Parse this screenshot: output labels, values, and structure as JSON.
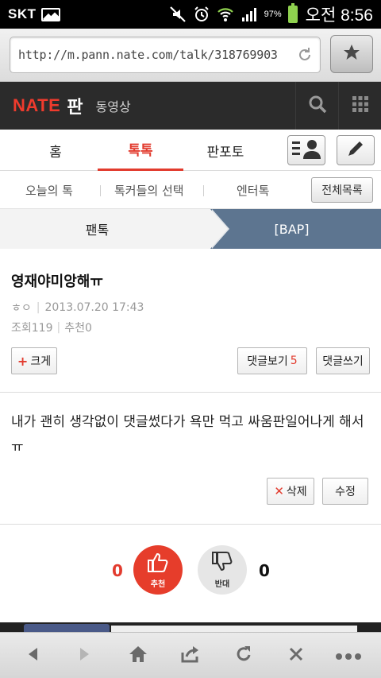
{
  "status_bar": {
    "carrier": "SKT",
    "battery_percent": "97%",
    "time": "오전 8:56"
  },
  "browser": {
    "url": "http://m.pann.nate.com/talk/318769903"
  },
  "header": {
    "logo": "NATE",
    "section": "판",
    "video_link": "동영상"
  },
  "main_tabs": [
    {
      "label": "홈",
      "active": false
    },
    {
      "label": "톡톡",
      "active": true
    },
    {
      "label": "판포토",
      "active": false
    }
  ],
  "sub_tabs": [
    {
      "label": "오늘의 톡"
    },
    {
      "label": "톡커들의 선택"
    },
    {
      "label": "엔터톡"
    }
  ],
  "all_list_button": "전체목록",
  "category": {
    "left": "팬톡",
    "right": "[BAP]"
  },
  "post": {
    "title": "영재야미앙해ㅠ",
    "author": "ㅎㅇ",
    "date": "2013.07.20 17:43",
    "views_label": "조회",
    "views": "119",
    "recommend_label": "추천",
    "recommend_count": "0",
    "enlarge_button": "크게",
    "view_comments_button": "댓글보기",
    "comment_count": "5",
    "write_comment_button": "댓글쓰기",
    "body": "내가 괜히 생각없이 댓글썼다가 욕만 먹고 싸움판일어나게 해서ㅠ",
    "delete_button": "삭제",
    "edit_button": "수정"
  },
  "vote": {
    "up_count": "0",
    "up_label": "추천",
    "down_label": "반대",
    "down_count": "0"
  },
  "colors": {
    "accent": "#e23b2e",
    "header_bg": "#2b2b2b",
    "category_bg": "#5d7590"
  }
}
